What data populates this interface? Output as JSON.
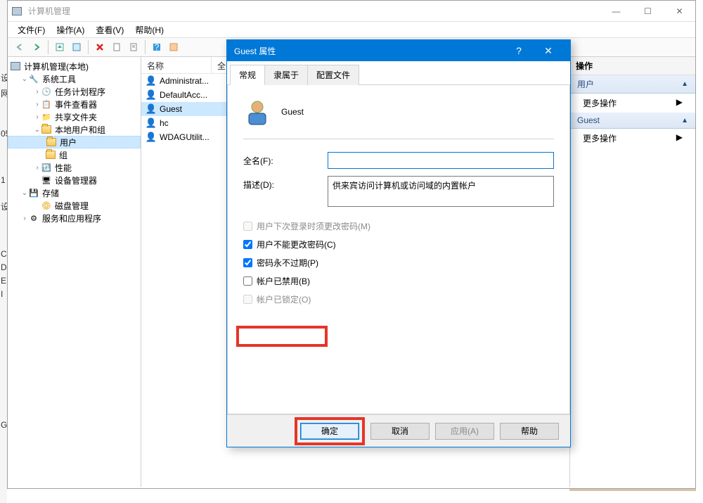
{
  "window": {
    "title": "计算机管理",
    "menus": {
      "file": "文件(F)",
      "action": "操作(A)",
      "view": "查看(V)",
      "help": "帮助(H)"
    },
    "controls": {
      "min": "—",
      "max": "☐",
      "close": "✕"
    }
  },
  "tree": {
    "root": "计算机管理(本地)",
    "system_tools": "系统工具",
    "task_scheduler": "任务计划程序",
    "event_viewer": "事件查看器",
    "shared_folders": "共享文件夹",
    "local_users_groups": "本地用户和组",
    "users": "用户",
    "groups": "组",
    "performance": "性能",
    "device_manager": "设备管理器",
    "storage": "存储",
    "disk_mgmt": "磁盘管理",
    "services_apps": "服务和应用程序"
  },
  "list": {
    "header_name": "名称",
    "header_full": "全",
    "rows": [
      "Administrat...",
      "DefaultAcc...",
      "Guest",
      "hc",
      "WDAGUtilit..."
    ]
  },
  "actions": {
    "title": "操作",
    "sect_user": "用户",
    "sect_guest": "Guest",
    "more": "更多操作"
  },
  "dialog": {
    "title": "Guest 属性",
    "tabs": {
      "general": "常规",
      "member": "隶属于",
      "profile": "配置文件"
    },
    "name_value": "Guest",
    "fullname_label": "全名(F):",
    "fullname_value": "",
    "desc_label": "描述(D):",
    "desc_value": "供来宾访问计算机或访问域的内置帐户",
    "chk_next_login": "用户下次登录时须更改密码(M)",
    "chk_cant_change": "用户不能更改密码(C)",
    "chk_never_expire": "密码永不过期(P)",
    "chk_disabled": "帐户已禁用(B)",
    "chk_locked": "帐户已锁定(O)",
    "btn_ok": "确定",
    "btn_cancel": "取消",
    "btn_apply": "应用(A)",
    "btn_help": "帮助"
  }
}
